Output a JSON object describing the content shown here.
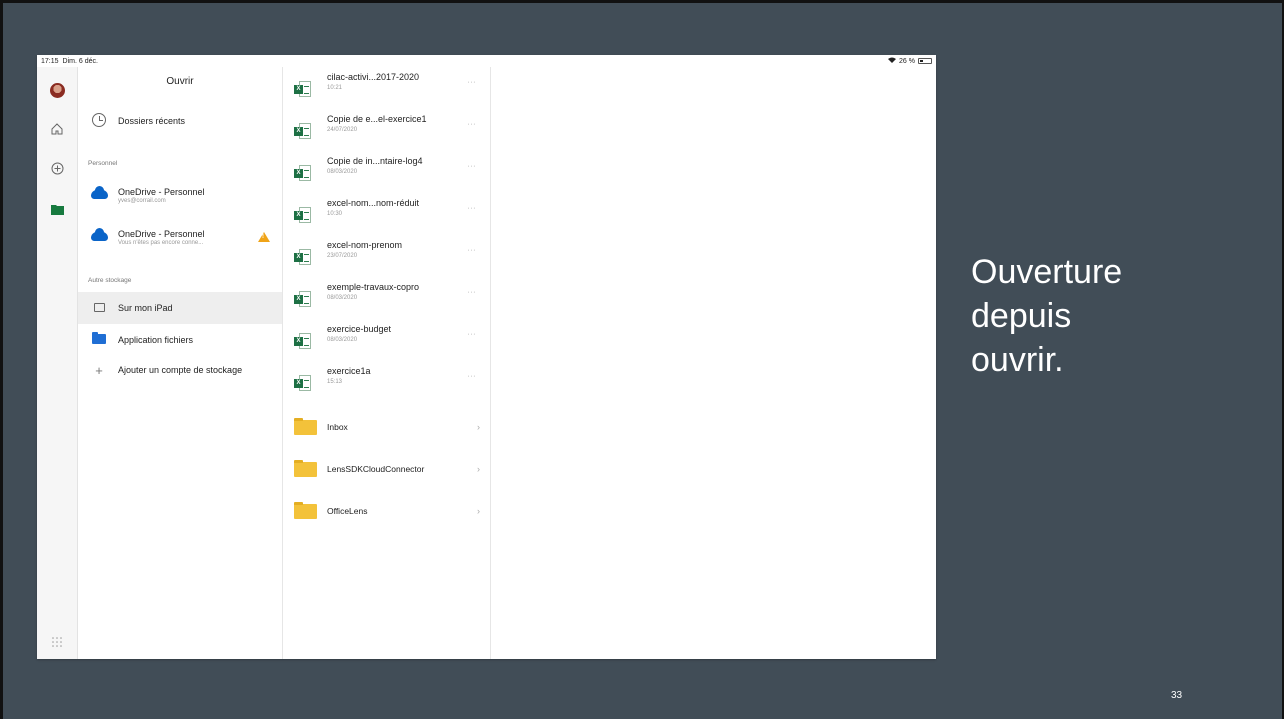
{
  "status_bar": {
    "time": "17:15",
    "date": "Dim. 6 déc.",
    "battery": "26 %"
  },
  "left_panel": {
    "title": "Ouvrir",
    "recent_folders": "Dossiers récents",
    "section_personal": "Personnel",
    "onedrive_1": {
      "title": "OneDrive - Personnel",
      "subtitle": "yves@corrail.com"
    },
    "onedrive_2": {
      "title": "OneDrive - Personnel",
      "subtitle": "Vous n'êtes pas encore conne..."
    },
    "section_other": "Autre stockage",
    "on_ipad": "Sur mon iPad",
    "files_app": "Application fichiers",
    "add_storage": "Ajouter un compte de stockage"
  },
  "files": [
    {
      "name": "cilac-activi...2017-2020",
      "date": "10:21"
    },
    {
      "name": "Copie de e...el-exercice1",
      "date": "24/07/2020"
    },
    {
      "name": "Copie de in...ntaire-log4",
      "date": "08/03/2020"
    },
    {
      "name": "excel-nom...nom-réduit",
      "date": "10:30"
    },
    {
      "name": "excel-nom-prenom",
      "date": "23/07/2020"
    },
    {
      "name": "exemple-travaux-copro",
      "date": "08/03/2020"
    },
    {
      "name": "exercice-budget",
      "date": "08/03/2020"
    },
    {
      "name": "exercice1a",
      "date": "15:13"
    }
  ],
  "folders": [
    {
      "name": "Inbox"
    },
    {
      "name": "LensSDKCloudConnector"
    },
    {
      "name": "OfficeLens"
    }
  ],
  "icons": {
    "excel": "X",
    "more": "···",
    "chevron": "›",
    "plus": "+",
    "warning": "!"
  },
  "caption": {
    "line1": "Ouverture",
    "line2": "depuis",
    "line3": "ouvrir."
  },
  "page_number": "33",
  "colors": {
    "slide_bg": "#414d57",
    "onedrive_blue": "#0a64c8",
    "excel_green": "#1d7044",
    "folder_yellow": "#f3c23a",
    "warning": "#f0a418"
  }
}
